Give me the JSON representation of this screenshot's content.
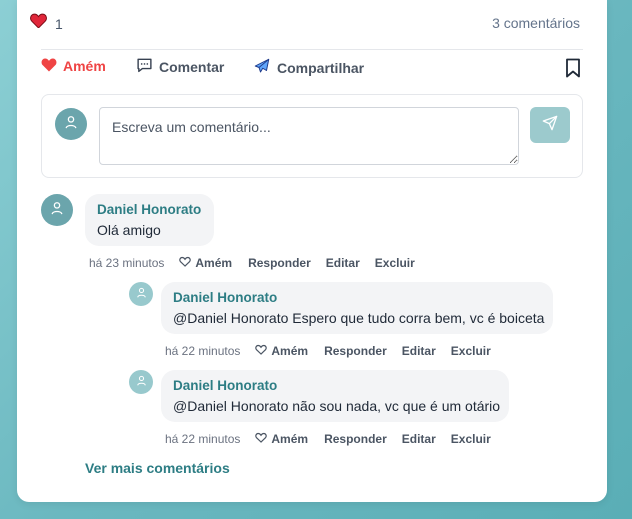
{
  "post": {
    "like_count": "1",
    "comments_count": "3 comentários"
  },
  "actions": {
    "amem": "Amém",
    "comentar": "Comentar",
    "compartilhar": "Compartilhar"
  },
  "compose": {
    "placeholder": "Escreva um comentário..."
  },
  "comments": [
    {
      "author": "Daniel Honorato",
      "text": "Olá amigo",
      "time": "há 23 minutos",
      "replies": [
        {
          "author": "Daniel Honorato",
          "text": "@Daniel Honorato Espero que tudo corra bem, vc é boiceta",
          "time": "há 22 minutos"
        },
        {
          "author": "Daniel Honorato",
          "text": "@Daniel Honorato não sou nada, vc que é um otário",
          "time": "há 22 minutos"
        }
      ]
    }
  ],
  "comment_actions": {
    "amem": "Amém",
    "responder": "Responder",
    "editar": "Editar",
    "excluir": "Excluir"
  },
  "more_comments": "Ver mais comentários",
  "colors": {
    "accent": "#2d7d84",
    "like": "#ef4444",
    "avatar": "#6ba5ac"
  }
}
